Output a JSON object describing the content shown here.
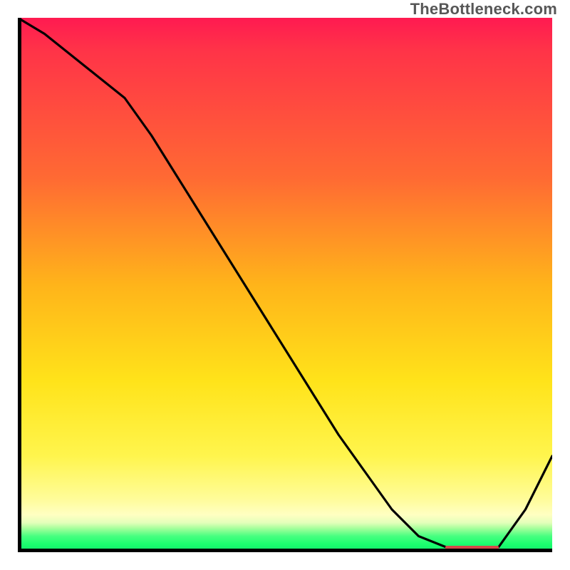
{
  "attribution": "TheBottleneck.com",
  "chart_data": {
    "type": "line",
    "title": "",
    "xlabel": "",
    "ylabel": "",
    "xlim": [
      0,
      100
    ],
    "ylim": [
      0,
      100
    ],
    "x": [
      0,
      5,
      10,
      15,
      20,
      25,
      30,
      35,
      40,
      45,
      50,
      55,
      60,
      65,
      70,
      75,
      80,
      85,
      90,
      95,
      100
    ],
    "values": [
      100,
      97,
      93,
      89,
      85,
      78,
      70,
      62,
      54,
      46,
      38,
      30,
      22,
      15,
      8,
      3,
      1,
      0,
      1,
      8,
      18
    ],
    "optimum_range": {
      "x_start": 80,
      "x_end": 90,
      "y": 0
    },
    "background_gradient": {
      "top": "#ff1a51",
      "mid_upper": "#ff6a33",
      "mid": "#ffe31a",
      "mid_lower": "#fffc99",
      "bottom": "#12e86b"
    }
  }
}
